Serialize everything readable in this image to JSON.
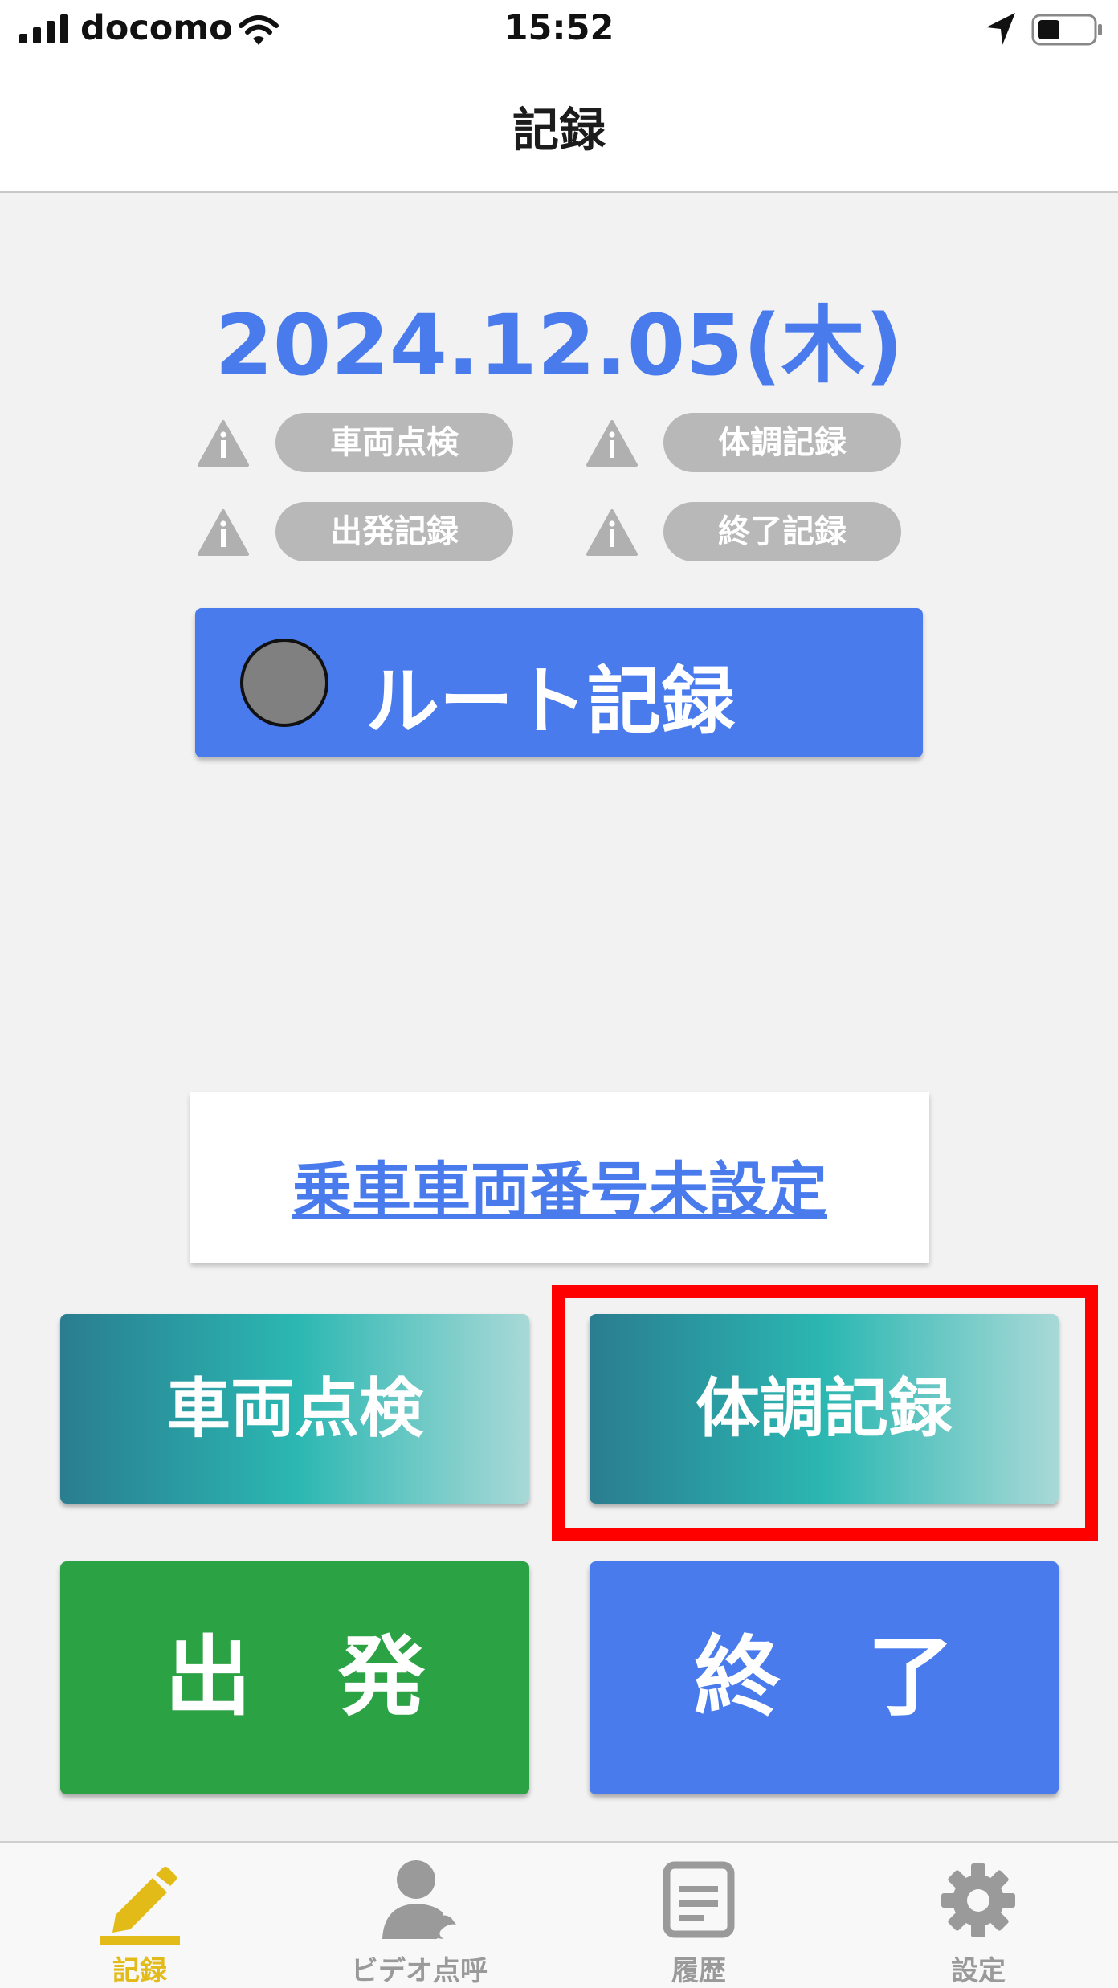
{
  "status_bar": {
    "carrier": "docomo",
    "time": "15:52",
    "icons": [
      "cellular-signal-icon",
      "wifi-icon",
      "location-arrow-icon",
      "battery-icon"
    ]
  },
  "nav": {
    "title": "記録"
  },
  "main": {
    "date": "2024.12.05(木)",
    "status_chips": [
      {
        "label": "車両点検",
        "icon": "warning-icon"
      },
      {
        "label": "体調記録",
        "icon": "warning-icon"
      },
      {
        "label": "出発記録",
        "icon": "warning-icon"
      },
      {
        "label": "終了記録",
        "icon": "warning-icon"
      }
    ],
    "route_button": {
      "label": "ルート記録"
    },
    "vehicle_link": "乗車車両番号未設定",
    "buttons": {
      "inspection": "車両点検",
      "health": "体調記録",
      "depart": "出　発",
      "finish": "終　了"
    }
  },
  "tabs": [
    {
      "label": "記録",
      "icon": "pencil-icon",
      "active": true
    },
    {
      "label": "ビデオ点呼",
      "icon": "video-call-person-icon",
      "active": false
    },
    {
      "label": "履歴",
      "icon": "history-document-icon",
      "active": false
    },
    {
      "label": "設定",
      "icon": "gear-icon",
      "active": false
    }
  ],
  "colors": {
    "accent_blue": "#4a7bed",
    "chip_gray": "#b8b8b8",
    "depart_green": "#2ba243",
    "active_tab": "#e3bb18",
    "highlight_red": "#ff0000",
    "gradient": [
      "#2a7d90",
      "#2bb7b2",
      "#a8d9d7"
    ]
  }
}
